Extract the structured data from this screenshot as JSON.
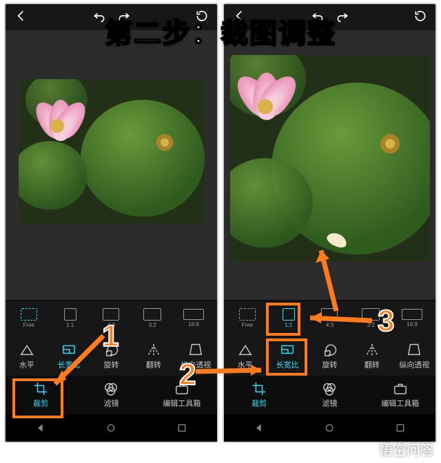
{
  "overlay_title": "第二步：裁图调整",
  "annotations": {
    "num1": "1",
    "num2": "2",
    "num3": "3"
  },
  "watermark": "悟空问答",
  "left": {
    "ratio": {
      "free": "Free",
      "r11": "1:1",
      "r43": "4:3",
      "r32": "3:2",
      "r169": "16:9"
    },
    "tools": {
      "level": "水平",
      "aspect": "长宽比",
      "rotate": "旋转",
      "flip": "翻转",
      "perspective": "纵向透视"
    },
    "tabs": {
      "crop": "裁剪",
      "filter": "滤镜",
      "toolbox": "编辑工具箱"
    }
  },
  "right": {
    "ratio": {
      "free": "Free",
      "r11": "1:1",
      "r43": "4:3",
      "r32": "3:2",
      "r169": "16:9"
    },
    "tools": {
      "level": "水平",
      "aspect": "长宽比",
      "rotate": "旋转",
      "flip": "翻转",
      "perspective": "纵向透视"
    },
    "tabs": {
      "crop": "裁剪",
      "filter": "滤镜",
      "toolbox": "编辑工具箱"
    }
  },
  "colors": {
    "accent": "#28e0ff",
    "annotation": "#ff7a1a"
  }
}
